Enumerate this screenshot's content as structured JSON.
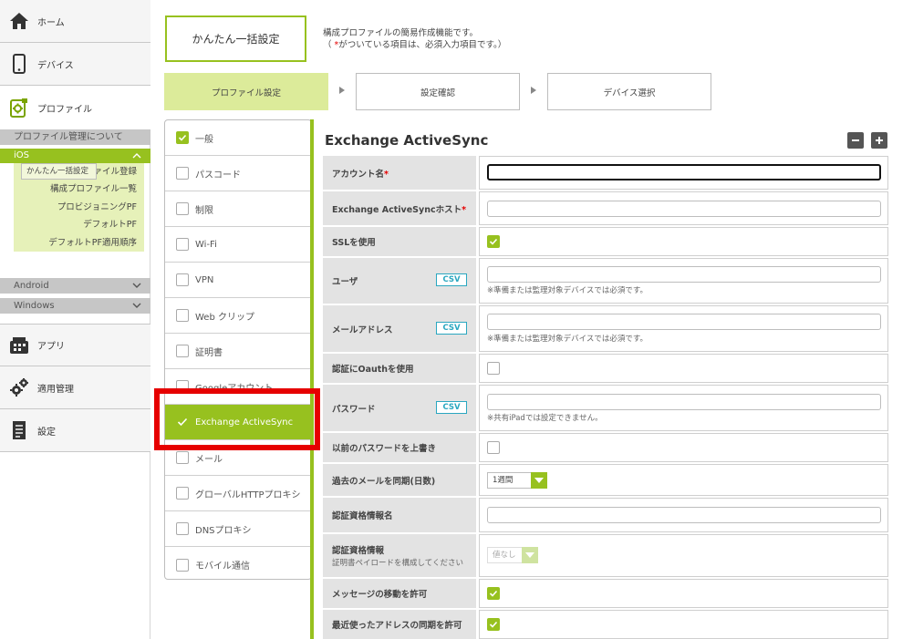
{
  "sidebar": {
    "home": "ホーム",
    "device": "デバイス",
    "profile": "プロファイル",
    "about_profile": "プロファイル管理について",
    "ios": "iOS",
    "ios_items": [
      "かんたん一括設定",
      "構成プロファイル登録",
      "構成プロファイル一覧",
      "プロビジョニングPF",
      "デフォルトPF",
      "デフォルトPF適用順序"
    ],
    "android": "Android",
    "windows": "Windows",
    "app": "アプリ",
    "apply_management": "適用管理",
    "settings": "設定"
  },
  "header": {
    "title": "かんたん一括設定",
    "desc_line1": "構成プロファイルの簡易作成機能です。",
    "desc_line2_pre": "（ ",
    "desc_line2_mark": "*",
    "desc_line2_post": "がついている項目は、必須入力項目です。）"
  },
  "steps": [
    "プロファイル設定",
    "設定確認",
    "デバイス選択"
  ],
  "tabs": [
    {
      "label": "一般",
      "checked": true
    },
    {
      "label": "パスコード",
      "checked": false
    },
    {
      "label": "制限",
      "checked": false
    },
    {
      "label": "Wi-Fi",
      "checked": false
    },
    {
      "label": "VPN",
      "checked": false
    },
    {
      "label": "Web クリップ",
      "checked": false
    },
    {
      "label": "証明書",
      "checked": false
    },
    {
      "label": "Googleアカウント",
      "checked": false
    },
    {
      "label": "Exchange ActiveSync",
      "checked": true,
      "active": true
    },
    {
      "label": "メール",
      "checked": false
    },
    {
      "label": "グローバルHTTPプロキシ",
      "checked": false
    },
    {
      "label": "DNSプロキシ",
      "checked": false
    },
    {
      "label": "モバイル通信",
      "checked": false
    }
  ],
  "panel": {
    "title": "Exchange ActiveSync",
    "fields": {
      "account_name": "アカウント名",
      "host": "Exchange ActiveSyncホスト",
      "ssl": "SSLを使用",
      "user": "ユーザ",
      "email": "メールアドレス",
      "oauth": "認証にOauthを使用",
      "password": "パスワード",
      "overwrite_prev_password": "以前のパスワードを上書き",
      "sync_days": "過去のメールを同期(日数)",
      "cred_name": "認証資格情報名",
      "cred": "認証資格情報",
      "cred_sub": "証明書ペイロードを構成してください",
      "allow_move": "メッセージの移動を許可",
      "sync_recent": "最近使ったアドレスの同期を許可"
    },
    "required_mark": "*",
    "csv": "CSV",
    "note_required": "※準備または監理対象デバイスでは必須です。",
    "note_shared_ipad": "※共有iPadでは設定できません。",
    "sync_days_value": "1週間",
    "cred_value": "値なし",
    "ssl_checked": true,
    "oauth_checked": false,
    "overwrite_checked": false,
    "allow_move_checked": true,
    "sync_recent_checked": true
  },
  "colors": {
    "accent": "#97c11f",
    "highlight": "#e60000",
    "csv": "#2aa7c0"
  }
}
